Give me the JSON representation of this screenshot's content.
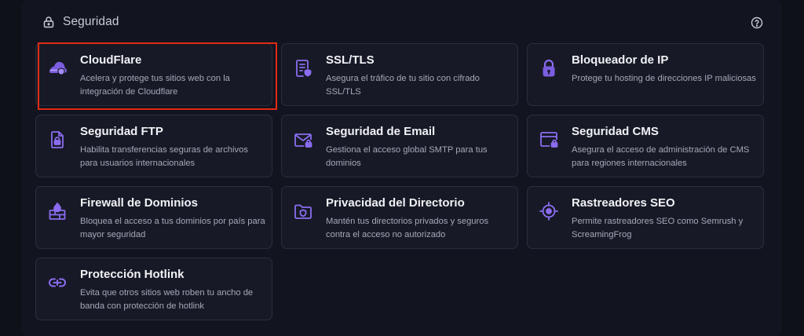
{
  "section": {
    "title": "Seguridad",
    "icon": "lock-icon",
    "help_icon": "help-circle-icon"
  },
  "accent_color": "#8b6cf0",
  "highlight_color": "#e02a14",
  "cards": [
    {
      "id": "cloudflare",
      "title": "CloudFlare",
      "description": "Acelera y protege tus sitios web con la integración de Cloudflare",
      "icon": "cloud-shield-icon",
      "highlighted": true
    },
    {
      "id": "ssl-tls",
      "title": "SSL/TLS",
      "description": "Asegura el tráfico de tu sitio con cifrado SSL/TLS",
      "icon": "certificate-icon"
    },
    {
      "id": "ip-blocker",
      "title": "Bloqueador de IP",
      "description": "Protege tu hosting de direcciones IP maliciosas",
      "icon": "padlock-icon"
    },
    {
      "id": "ftp-security",
      "title": "Seguridad FTP",
      "description": "Habilita transferencias seguras de archivos para usuarios internacionales",
      "icon": "file-lock-icon"
    },
    {
      "id": "email-security",
      "title": "Seguridad de Email",
      "description": "Gestiona el acceso global SMTP para tus dominios",
      "icon": "mail-lock-icon"
    },
    {
      "id": "cms-security",
      "title": "Seguridad CMS",
      "description": "Asegura el acceso de administración de CMS para regiones internacionales",
      "icon": "browser-lock-icon"
    },
    {
      "id": "domain-firewall",
      "title": "Firewall de Dominios",
      "description": "Bloquea el acceso a tus dominios por país para mayor seguridad",
      "icon": "firewall-icon"
    },
    {
      "id": "directory-privacy",
      "title": "Privacidad del Directorio",
      "description": "Mantén tus directorios privados y seguros contra el acceso no autorizado",
      "icon": "folder-shield-icon"
    },
    {
      "id": "seo-crawlers",
      "title": "Rastreadores SEO",
      "description": "Permite rastreadores SEO como Semrush y ScreamingFrog",
      "icon": "crosshair-icon"
    },
    {
      "id": "hotlink-protection",
      "title": "Protección Hotlink",
      "description": "Evita que otros sitios web roben tu ancho de banda con protección de hotlink",
      "icon": "link-block-icon"
    }
  ]
}
